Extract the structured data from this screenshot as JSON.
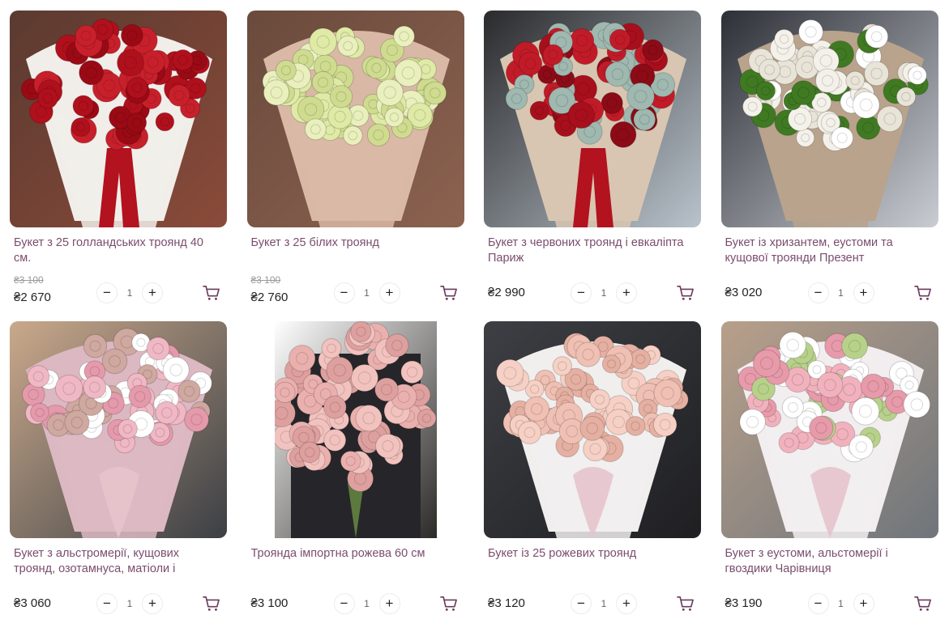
{
  "currency_symbol": "₴",
  "colors": {
    "title": "#7a4d6e",
    "cart_icon": "#6b3a5e",
    "old_price": "#9a9a9a"
  },
  "icons": {
    "minus": "−",
    "plus": "+",
    "cart": "cart-icon"
  },
  "products": [
    {
      "title": "Букет з 25 голландських троянд 40 см.",
      "old_price": "₴3 100",
      "price": "₴2 670",
      "qty": "1",
      "photo": "red-roses-bouquet"
    },
    {
      "title": "Букет з 25 білих троянд",
      "old_price": "₴3 100",
      "price": "₴2 760",
      "qty": "1",
      "photo": "white-roses-bouquet"
    },
    {
      "title": "Букет з червоних троянд і евкаліпта Париж",
      "old_price": "",
      "price": "₴2 990",
      "qty": "1",
      "photo": "red-roses-eucalyptus"
    },
    {
      "title": "Букет із хризантем, еустоми та кущової троянди Презент",
      "old_price": "",
      "price": "₴3 020",
      "qty": "1",
      "photo": "white-green-chrysanthemum"
    },
    {
      "title": "Букет з альстромерії, кущових троянд, озотамнуса, матіоли і",
      "old_price": "",
      "price": "₴3 060",
      "qty": "1",
      "photo": "pink-mixed-bouquet"
    },
    {
      "title": "Троянда імпортна рожева 60 см",
      "old_price": "",
      "price": "₴3 100",
      "qty": "1",
      "photo": "pink-roses-long"
    },
    {
      "title": "Букет із 25 рожевих троянд",
      "old_price": "",
      "price": "₴3 120",
      "qty": "1",
      "photo": "pink-roses-wrapped"
    },
    {
      "title": "Букет з еустоми, альстомерії і гвоздики Чарівниця",
      "old_price": "",
      "price": "₴3 190",
      "qty": "1",
      "photo": "pink-white-eustoma"
    }
  ]
}
